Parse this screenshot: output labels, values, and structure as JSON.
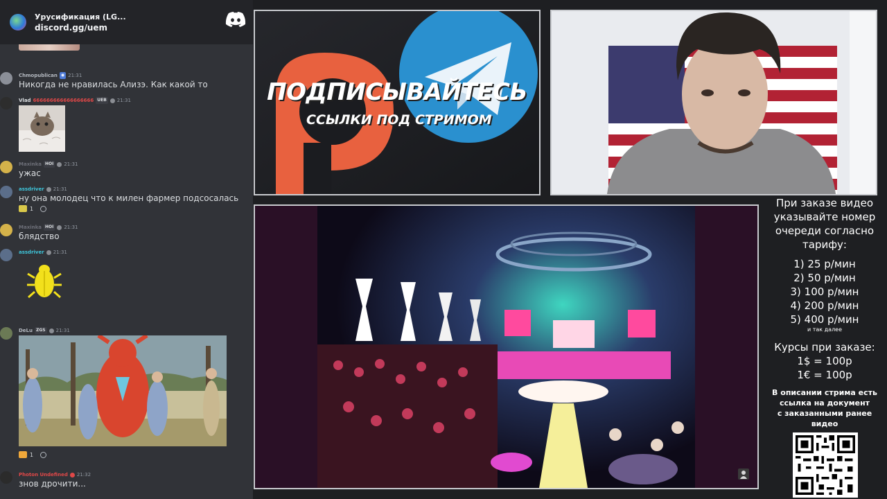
{
  "server": {
    "name": "Урусификация (LG...",
    "link": "discord.gg/uem"
  },
  "messages": [
    {
      "user": "Chmopublican",
      "user_color": "#b5bac1",
      "time": "21:31",
      "text": "Никогда не нравилась Ализэ. Как какой то"
    },
    {
      "user": "Vlad",
      "user_color": "#dbdee1",
      "extra": "666666666666666666",
      "tag": "UEB",
      "time": "21:31"
    },
    {
      "user": "Maxinka",
      "user_color": "#6d6f78",
      "tag": "HOI",
      "time": "21:31",
      "text": "ужас"
    },
    {
      "user": "assdriver",
      "user_color": "#3ec3d8",
      "time": "21:31",
      "text": "ну она молодец что к милен фармер подсосалась",
      "reaction_count": "1"
    },
    {
      "user": "Maxinka",
      "user_color": "#6d6f78",
      "tag": "HOI",
      "time": "21:31",
      "text": "блядство"
    },
    {
      "user": "assdriver",
      "user_color": "#3ec3d8",
      "time": "21:31"
    },
    {
      "user": "DeLu",
      "user_color": "#b5bac1",
      "tag": "ZGS",
      "time": "21:31",
      "reaction_count": "1"
    },
    {
      "user": "Photon Undefined",
      "user_color": "#e04848",
      "time": "21:32",
      "text": "знов дрочити..."
    }
  ],
  "promo": {
    "title": "ПОДПИСЫВАЙТЕСЬ",
    "subtitle": "ССЫЛКИ ПОД СТРИМОМ",
    "colors": {
      "patreon": "#e8613f",
      "telegram": "#2a90cf"
    }
  },
  "info": {
    "intro": [
      "При заказе видео",
      "указывайте номер",
      "очереди согласно",
      "тарифу:"
    ],
    "tiers": [
      "1) 25 р/мин",
      "2) 50 р/мин",
      "3) 100 р/мин",
      "4) 200 р/мин",
      "5) 400 р/мин"
    ],
    "more": "и так далее",
    "rates_title": "Курсы при заказе:",
    "rates": [
      "1$ = 100р",
      "1€ = 100р"
    ],
    "note": [
      "В описании стрима есть",
      "ссылка на документ",
      "с заказанными ранее",
      "видео"
    ]
  }
}
